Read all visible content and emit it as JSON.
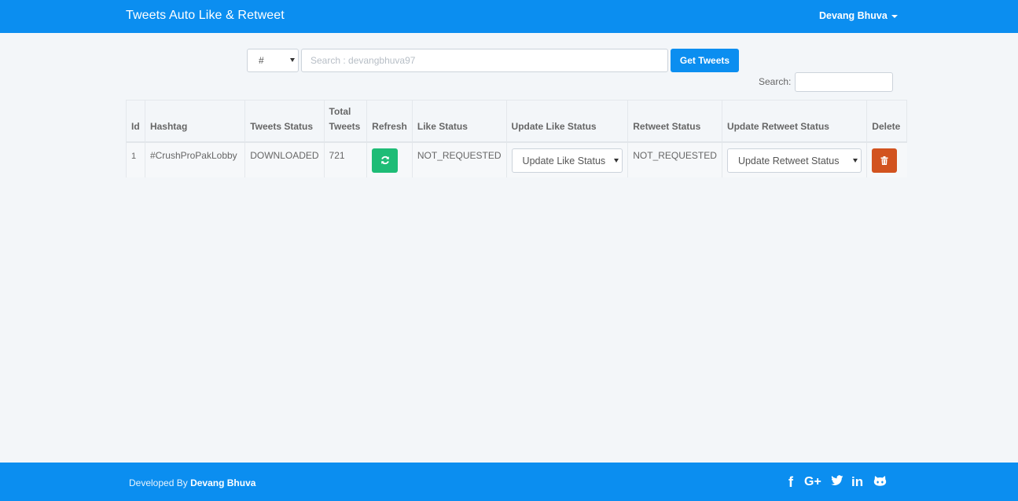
{
  "navbar": {
    "brand": "Tweets Auto Like & Retweet",
    "user": "Devang Bhuva"
  },
  "search": {
    "type_value": "#",
    "placeholder": "Search : devangbhuva97",
    "button_label": "Get Tweets",
    "filter_label": "Search:"
  },
  "table": {
    "headers": {
      "id": "Id",
      "hashtag": "Hashtag",
      "tweets_status": "Tweets Status",
      "total_tweets_1": "Total",
      "total_tweets_2": "Tweets",
      "refresh": "Refresh",
      "like_status": "Like Status",
      "update_like_status": "Update Like Status",
      "retweet_status": "Retweet Status",
      "update_retweet_status": "Update Retweet Status",
      "delete": "Delete"
    },
    "rows": [
      {
        "id": "1",
        "hashtag": "#CrushProPakLobby",
        "tweets_status": "DOWNLOADED",
        "total_tweets": "721",
        "like_status": "NOT_REQUESTED",
        "update_like_status": "Update Like Status",
        "retweet_status": "NOT_REQUESTED",
        "update_retweet_status": "Update Retweet Status"
      }
    ]
  },
  "footer": {
    "prefix": "Developed By",
    "author": "Devang Bhuva",
    "social": {
      "facebook": "f",
      "google_plus": "G+",
      "twitter": "twitter",
      "linkedin": "in",
      "github": "github"
    }
  },
  "colors": {
    "primary": "#0b8ef0",
    "success": "#1ebc76",
    "danger": "#d2531f",
    "background": "#f3f6f9"
  }
}
